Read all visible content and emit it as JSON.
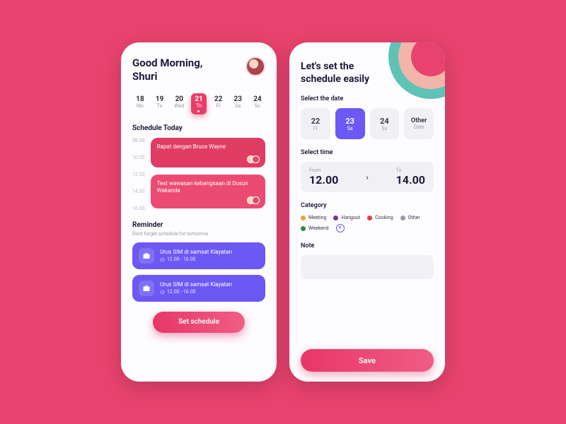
{
  "left": {
    "greeting_line1": "Good Morning,",
    "greeting_line2": "Shuri",
    "dates": [
      {
        "num": "18",
        "dow": "Mo"
      },
      {
        "num": "19",
        "dow": "Tu"
      },
      {
        "num": "20",
        "dow": "Wed"
      },
      {
        "num": "21",
        "dow": "Th",
        "selected": true
      },
      {
        "num": "22",
        "dow": "Fr"
      },
      {
        "num": "23",
        "dow": "Sa"
      },
      {
        "num": "24",
        "dow": "Su"
      }
    ],
    "schedule_label": "Schedule Today",
    "time_scale": [
      "08.00",
      "10.00",
      "12.00",
      "14.00",
      "16.00"
    ],
    "events": [
      {
        "title": "Rapat dengan Bruce Wayne"
      },
      {
        "title": "Test wawasan kebangsaan di Dusun Wakanda"
      }
    ],
    "reminder_label": "Reminder",
    "reminder_sub": "Dont forget schedule for tomorrow",
    "reminders": [
      {
        "title": "Urus SIM di samsat Klayatan",
        "time": "12.00 - 16.00"
      },
      {
        "title": "Urus SIM di samsat Klayatan",
        "time": "12.00 - 16.00"
      }
    ],
    "set_btn": "Set schedule"
  },
  "right": {
    "title_line1": "Let's set the",
    "title_line2": "schedule easily",
    "select_date_label": "Select the date",
    "dates": [
      {
        "num": "22",
        "dow": "Fr"
      },
      {
        "num": "23",
        "dow": "Sa",
        "selected": true
      },
      {
        "num": "24",
        "dow": "Su"
      },
      {
        "num": "Other",
        "dow": "Date"
      }
    ],
    "select_time_label": "Select time",
    "from_label": "From",
    "from_value": "12.00",
    "to_label": "To",
    "to_value": "14.00",
    "category_label": "Category",
    "categories": [
      {
        "name": "Meeting",
        "color": "#f0a43a"
      },
      {
        "name": "Hangout",
        "color": "#6d3a8f"
      },
      {
        "name": "Cooking",
        "color": "#e13c4c"
      },
      {
        "name": "Other",
        "color": "#9b9ba6"
      },
      {
        "name": "Weekend",
        "color": "#2e8a4a"
      }
    ],
    "note_label": "Note",
    "save_btn": "Save"
  }
}
